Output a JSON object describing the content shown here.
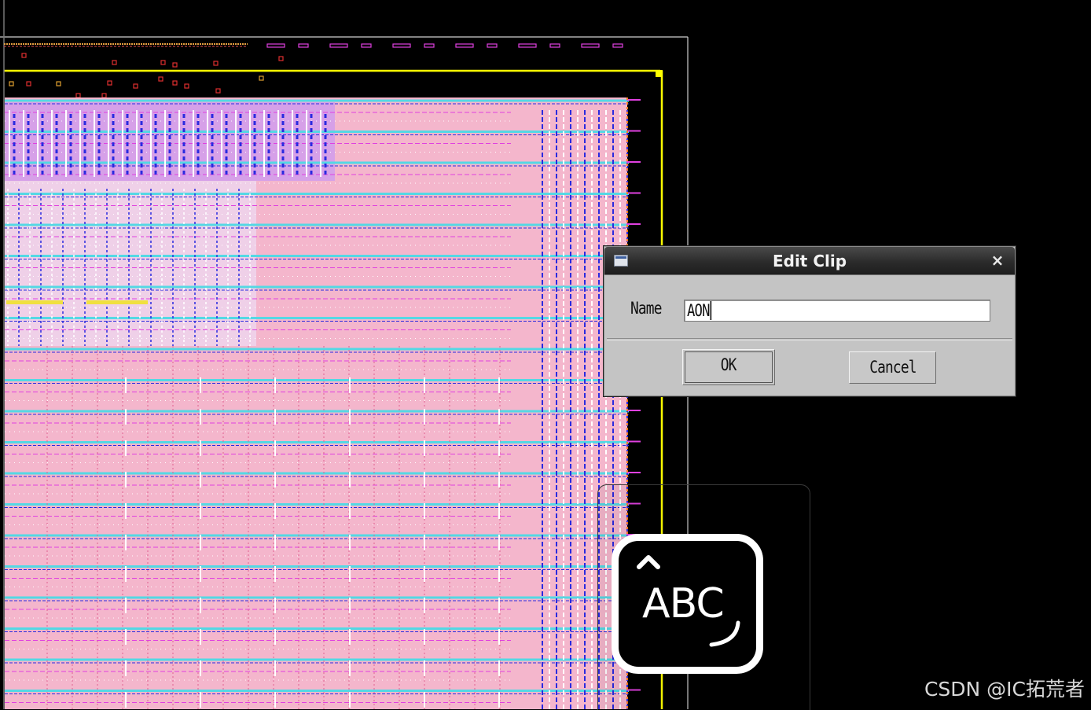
{
  "dialog": {
    "title": "Edit Clip",
    "close_glyph": "×",
    "name_label": "Name",
    "name_value": "AON",
    "ok_label": "OK",
    "cancel_label": "Cancel"
  },
  "ime": {
    "label": "ABC"
  },
  "watermark": "CSDN @IC拓荒者",
  "icons": [
    "dialog-app-icon",
    "close-icon",
    "caret-up-icon",
    "input-method-icon"
  ],
  "colors": {
    "background": "#000000",
    "cell_fill": "#f4b6cc",
    "metal_cyan": "#54d8e4",
    "metal_blue": "#2a2adf",
    "metal_magenta": "#e040e0",
    "boundary_yellow": "#ffff00",
    "dialog_bg": "#c4c4c4",
    "titlebar": "#2b2b2b"
  }
}
